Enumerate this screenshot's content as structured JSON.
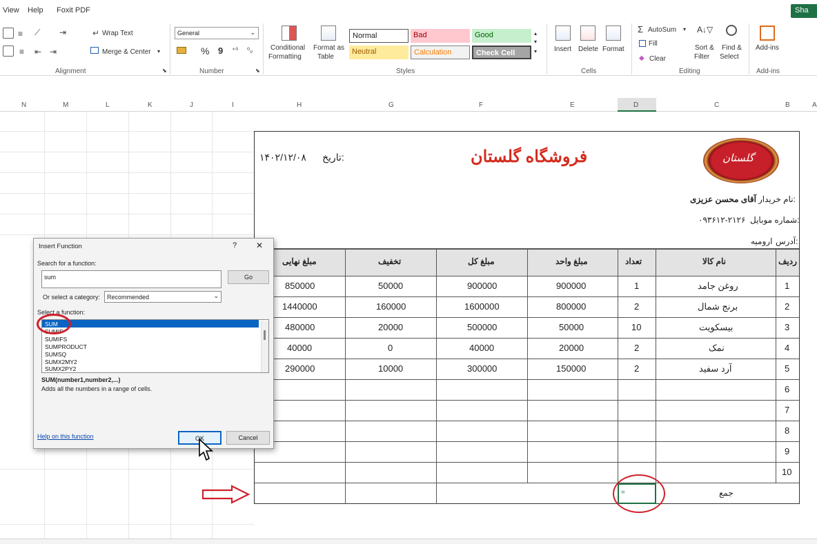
{
  "menu": {
    "items": [
      "View",
      "Help",
      "Foxit PDF"
    ],
    "share": "Sha"
  },
  "ribbon": {
    "alignment": {
      "wrap_text": "Wrap Text",
      "merge_center": "Merge & Center",
      "label": "Alignment"
    },
    "number": {
      "format": "General",
      "label": "Number",
      "percent": "%",
      "comma": "9"
    },
    "styles": {
      "conditional": "Conditional",
      "formatting": "Formatting",
      "format_as": "Format as",
      "table": "Table",
      "normal": "Normal",
      "bad": "Bad",
      "good": "Good",
      "neutral": "Neutral",
      "calculation": "Calculation",
      "check_cell": "Check Cell",
      "label": "Styles"
    },
    "cells": {
      "insert": "Insert",
      "delete": "Delete",
      "format": "Format",
      "label": "Cells"
    },
    "editing": {
      "autosum": "AutoSum",
      "fill": "Fill",
      "clear": "Clear",
      "sort": "Sort &",
      "filter": "Filter",
      "find": "Find &",
      "select": "Select",
      "label": "Editing"
    },
    "addins": {
      "addins": "Add-ins",
      "label": "Add-ins"
    }
  },
  "columns": [
    "N",
    "M",
    "L",
    "K",
    "J",
    "I",
    "H",
    "G",
    "F",
    "E",
    "D",
    "C",
    "B",
    "A"
  ],
  "invoice": {
    "shop_name": "فروشگاه گلستان",
    "logo_text": "گلستان",
    "date_label": "تاریخ:",
    "date_value": "۱۴۰۲/۱۲/۰۸",
    "buyer_label": "نام خریدار:",
    "buyer_value": "آقای محسن عزیزی",
    "mobile_label": "شماره موبایل:",
    "mobile_value": "۰۹۳۶۱۲-۲۱۲۶",
    "address_label": "آدرس:",
    "address_value": "ارومیه",
    "headers": {
      "row": "ردیف",
      "item": "نام کالا",
      "qty": "تعداد",
      "unit_price": "مبلغ واحد",
      "total": "مبلغ کل",
      "discount": "تخفیف",
      "final": "مبلغ نهایی"
    },
    "rows": [
      {
        "n": "1",
        "item": "روغن جامد",
        "qty": "1",
        "unit": "900000",
        "total": "900000",
        "disc": "50000",
        "final": "850000"
      },
      {
        "n": "2",
        "item": "برنج شمال",
        "qty": "2",
        "unit": "800000",
        "total": "1600000",
        "disc": "160000",
        "final": "1440000"
      },
      {
        "n": "3",
        "item": "بیسکویت",
        "qty": "10",
        "unit": "50000",
        "total": "500000",
        "disc": "20000",
        "final": "480000"
      },
      {
        "n": "4",
        "item": "نمک",
        "qty": "2",
        "unit": "20000",
        "total": "40000",
        "disc": "0",
        "final": "40000"
      },
      {
        "n": "5",
        "item": "آرد سفید",
        "qty": "2",
        "unit": "150000",
        "total": "300000",
        "disc": "10000",
        "final": "290000"
      },
      {
        "n": "6"
      },
      {
        "n": "7"
      },
      {
        "n": "8"
      },
      {
        "n": "9"
      },
      {
        "n": "10"
      }
    ],
    "sum_label": "جمع",
    "sum_cell_value": "="
  },
  "dialog": {
    "title": "Insert Function",
    "help_glyph": "?",
    "close_glyph": "✕",
    "search_label": "Search for a function:",
    "search_value": "sum",
    "go": "Go",
    "category_label": "Or select a category:",
    "category_value": "Recommended",
    "select_label": "Select a function:",
    "functions": [
      "SUM",
      "SUMIF",
      "SUMIFS",
      "SUMPRODUCT",
      "SUMSQ",
      "SUMX2MY2",
      "SUMX2PY2"
    ],
    "signature": "SUM(number1,number2,...)",
    "description": "Adds all the numbers in a range of cells.",
    "help_link": "Help on this function",
    "ok": "OK",
    "cancel": "Cancel"
  },
  "colors": {
    "accent_red": "#d52b1e",
    "excel_green": "#1e7145",
    "annotation_red": "#cf1f2a"
  }
}
